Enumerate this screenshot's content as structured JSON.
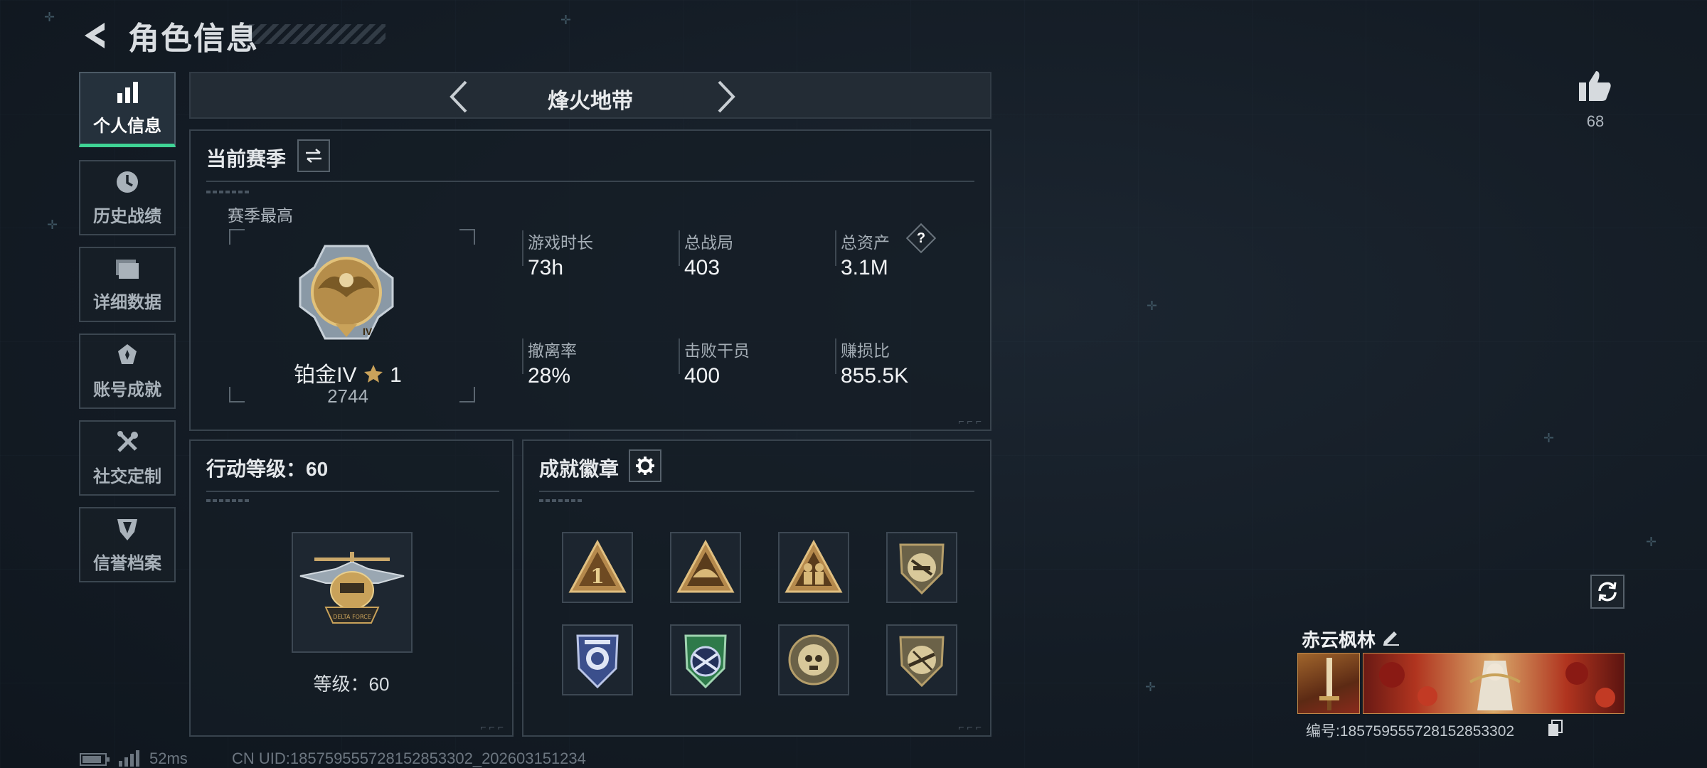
{
  "header": {
    "title": "角色信息"
  },
  "sidebar": {
    "items": [
      {
        "label": "个人信息",
        "icon": "bar-chart-icon",
        "active": true
      },
      {
        "label": "历史战绩",
        "icon": "clock-icon",
        "active": false
      },
      {
        "label": "详细数据",
        "icon": "folder-icon",
        "active": false
      },
      {
        "label": "账号成就",
        "icon": "achievement-icon",
        "active": false
      },
      {
        "label": "社交定制",
        "icon": "tools-icon",
        "active": false
      },
      {
        "label": "信誉档案",
        "icon": "shield-icon",
        "active": false
      }
    ]
  },
  "mode": {
    "title": "烽火地带"
  },
  "season": {
    "title": "当前赛季",
    "best_label": "赛季最高",
    "rank_name": "铂金IV",
    "rank_stars": "1",
    "rank_score": "2744",
    "rank_numeral": "IV",
    "stats": [
      {
        "label": "游戏时长",
        "value": "73h"
      },
      {
        "label": "总战局",
        "value": "403"
      },
      {
        "label": "总资产",
        "value": "3.1M",
        "help": "?"
      },
      {
        "label": "撤离率",
        "value": "28%"
      },
      {
        "label": "击败干员",
        "value": "400"
      },
      {
        "label": "赚损比",
        "value": "855.5K"
      }
    ]
  },
  "level": {
    "title": "行动等级：60",
    "label": "等级：60",
    "emblem_text": "DELTA FORCE"
  },
  "achievements": {
    "title": "成就徽章",
    "badges": [
      "rank-one-triangle-icon",
      "helmet-triangle-icon",
      "soldiers-triangle-icon",
      "no-gun-shield-icon",
      "police-shield-icon",
      "target-shield-icon",
      "skull-round-icon",
      "rifle-shield-icon"
    ]
  },
  "right": {
    "likes": "68",
    "player_name": "赤云枫林",
    "player_id": "编号:185759555728152853302"
  },
  "status": {
    "ping": "52ms",
    "uid": "CN UID:185759555728152853302_202603151234"
  },
  "colors": {
    "accent": "#3fd495",
    "gold": "#c9a25a"
  }
}
